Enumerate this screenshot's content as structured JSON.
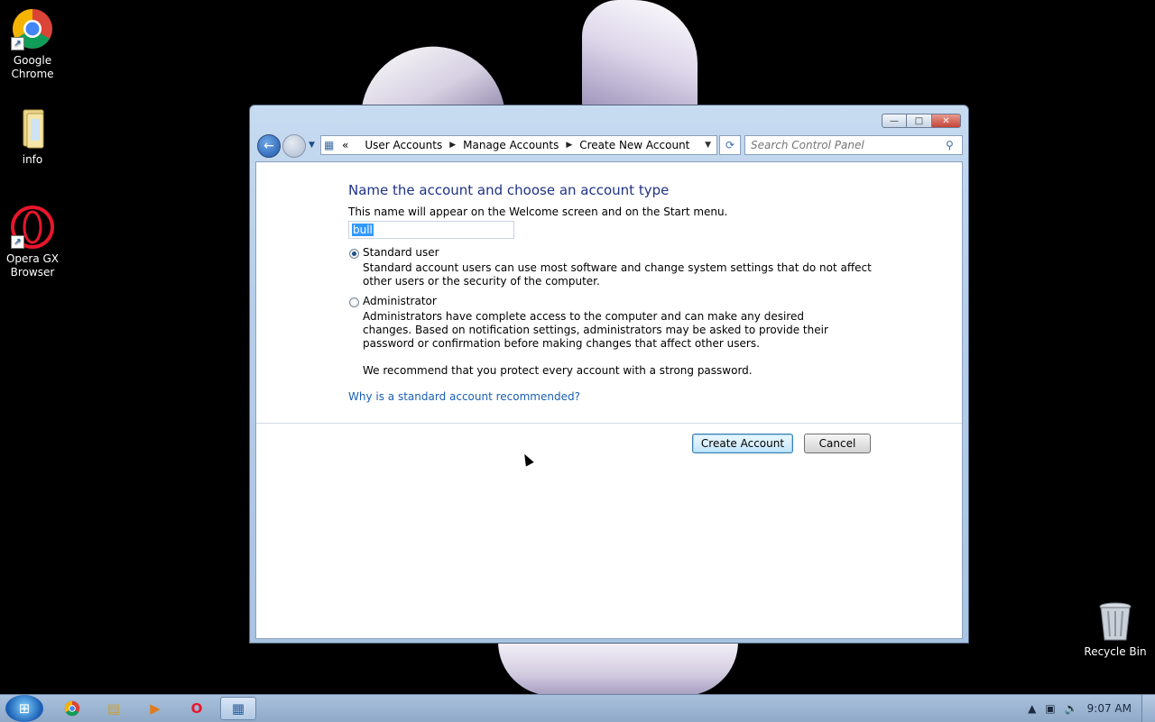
{
  "desktop": {
    "icons": [
      {
        "label_line1": "Google",
        "label_line2": "Chrome"
      },
      {
        "label_line1": "info",
        "label_line2": ""
      },
      {
        "label_line1": "Opera GX",
        "label_line2": "Browser"
      },
      {
        "label_line1": "Recycle Bin",
        "label_line2": ""
      }
    ]
  },
  "window": {
    "caption": {
      "minimize": "—",
      "maximize": "□",
      "close": "✕"
    },
    "breadcrumb": {
      "overflow": "«",
      "items": [
        "User Accounts",
        "Manage Accounts",
        "Create New Account"
      ]
    },
    "search": {
      "placeholder": "Search Control Panel"
    },
    "content": {
      "heading": "Name the account and choose an account type",
      "subtext": "This name will appear on the Welcome screen and on the Start menu.",
      "name_value": "bull",
      "options": [
        {
          "label": "Standard user",
          "checked": true,
          "description": "Standard account users can use most software and change system settings that do not affect other users or the security of the computer."
        },
        {
          "label": "Administrator",
          "checked": false,
          "description": "Administrators have complete access to the computer and can make any desired changes. Based on notification settings, administrators may be asked to provide their password or confirmation before making changes that affect other users."
        }
      ],
      "recommendation": "We recommend that you protect every account with a strong password.",
      "help_link": "Why is a standard account recommended?",
      "create_button": "Create Account",
      "cancel_button": "Cancel"
    }
  },
  "taskbar": {
    "clock": "9:07 AM"
  },
  "colors": {
    "heading": "#1e3287",
    "link": "#1a5fb4",
    "selection": "#3399ff"
  }
}
